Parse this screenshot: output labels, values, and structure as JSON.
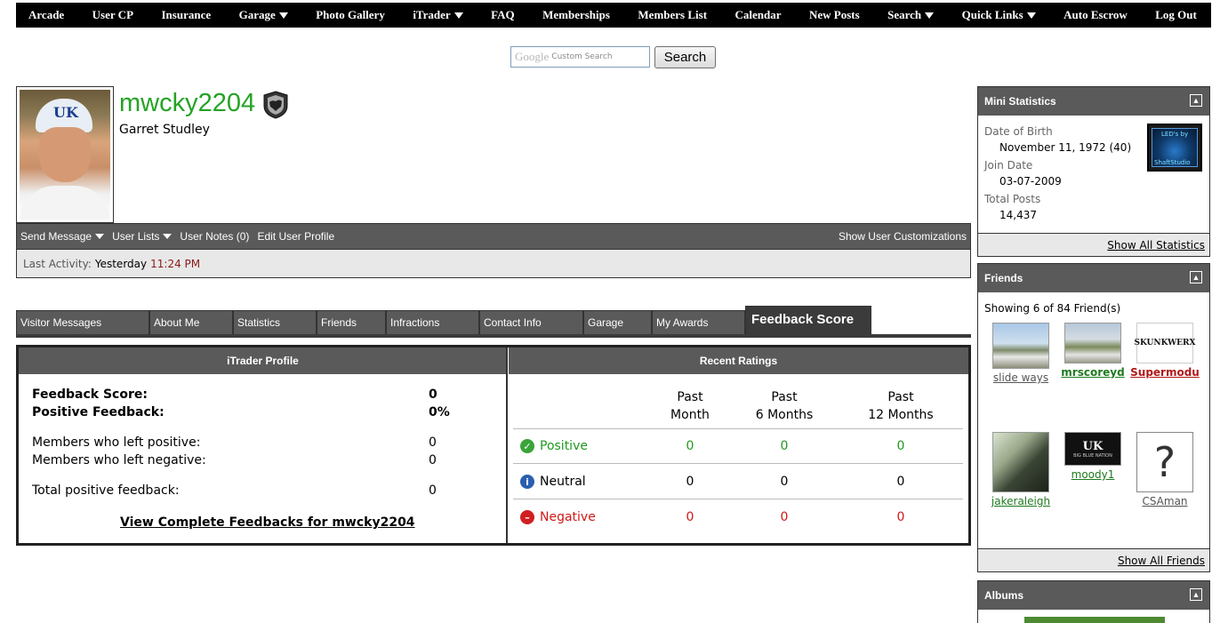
{
  "topnav": {
    "items": [
      {
        "label": "Arcade",
        "dropdown": false
      },
      {
        "label": "User CP",
        "dropdown": false
      },
      {
        "label": "Insurance",
        "dropdown": false
      },
      {
        "label": "Garage",
        "dropdown": true
      },
      {
        "label": "Photo Gallery",
        "dropdown": false
      },
      {
        "label": "iTrader",
        "dropdown": true
      },
      {
        "label": "FAQ",
        "dropdown": false
      },
      {
        "label": "Memberships",
        "dropdown": false
      },
      {
        "label": "Members List",
        "dropdown": false
      },
      {
        "label": "Calendar",
        "dropdown": false
      },
      {
        "label": "New Posts",
        "dropdown": false
      },
      {
        "label": "Search",
        "dropdown": true
      },
      {
        "label": "Quick Links",
        "dropdown": true
      },
      {
        "label": "Auto Escrow",
        "dropdown": false
      },
      {
        "label": "Log Out",
        "dropdown": false
      }
    ]
  },
  "search": {
    "logo_text": "Google",
    "placeholder_text": "Custom Search",
    "button_label": "Search"
  },
  "profile": {
    "username": "mwcky2204",
    "real_name": "Garret Studley",
    "avatar_cap_text": "UK",
    "username_color": "#25a325"
  },
  "profilebar": {
    "send_message": "Send Message",
    "user_lists": "User Lists",
    "user_notes": "User Notes (0)",
    "edit_profile": "Edit User Profile",
    "show_customizations": "Show User Customizations"
  },
  "last_activity": {
    "label": "Last Activity:",
    "day": "Yesterday",
    "time": "11:24 PM"
  },
  "tabs": [
    {
      "label": "Visitor Messages"
    },
    {
      "label": "About Me"
    },
    {
      "label": "Statistics"
    },
    {
      "label": "Friends"
    },
    {
      "label": "Infractions"
    },
    {
      "label": "Contact Info"
    },
    {
      "label": "Garage"
    },
    {
      "label": "My Awards"
    },
    {
      "label": "Feedback Score",
      "active": true
    }
  ],
  "itrader": {
    "header": "iTrader Profile",
    "feedback_score_label": "Feedback Score:",
    "feedback_score": "0",
    "positive_feedback_label": "Positive Feedback:",
    "positive_feedback": "0%",
    "members_positive_label": "Members who left positive:",
    "members_positive": "0",
    "members_negative_label": "Members who left negative:",
    "members_negative": "0",
    "total_positive_label": "Total positive feedback:",
    "total_positive": "0",
    "view_link": "View Complete Feedbacks for mwcky2204"
  },
  "recent_ratings": {
    "header": "Recent Ratings",
    "columns": [
      {
        "line1": "Past",
        "line2": "Month"
      },
      {
        "line1": "Past",
        "line2": "6 Months"
      },
      {
        "line1": "Past",
        "line2": "12 Months"
      }
    ],
    "rows": [
      {
        "label": "Positive",
        "color": "#1e9a1e",
        "icon_color": "#3aa43a",
        "icon_char": "✓",
        "values": [
          "0",
          "0",
          "0"
        ]
      },
      {
        "label": "Neutral",
        "color": "#000000",
        "icon_color": "#2a5fb0",
        "icon_char": "i",
        "values": [
          "0",
          "0",
          "0"
        ]
      },
      {
        "label": "Negative",
        "color": "#d01818",
        "icon_color": "#d02020",
        "icon_char": "–",
        "values": [
          "0",
          "0",
          "0"
        ]
      }
    ]
  },
  "mini_stats": {
    "title": "Mini Statistics",
    "dob_label": "Date of Birth",
    "dob": "November 11, 1972 (40)",
    "join_label": "Join Date",
    "join": "03-07-2009",
    "posts_label": "Total Posts",
    "posts": "14,437",
    "show_all": "Show All Statistics",
    "sig_text_top": "LED's by",
    "sig_text_bottom": "ShaftStudio"
  },
  "friends": {
    "title": "Friends",
    "showing": "Showing 6 of 84 Friend(s)",
    "list": [
      {
        "name": "slide ways",
        "color": "#555555",
        "style": "normal"
      },
      {
        "name": "mrscoreyd",
        "color": "#1e7a1e",
        "style": "bold"
      },
      {
        "name": "Supermodu",
        "color": "#b01818",
        "style": "bold"
      },
      {
        "name": "jakeraleigh",
        "color": "#1e7a1e",
        "style": "normal"
      },
      {
        "name": "moody1",
        "color": "#1e7a1e",
        "style": "normal"
      },
      {
        "name": "CSAman",
        "color": "#555555",
        "style": "normal"
      }
    ],
    "skunk_text": "SKUNKWERX",
    "kentucky_text": "UK",
    "kentucky_sub": "BIG BLUE NATION",
    "show_all": "Show All Friends"
  },
  "albums": {
    "title": "Albums"
  }
}
